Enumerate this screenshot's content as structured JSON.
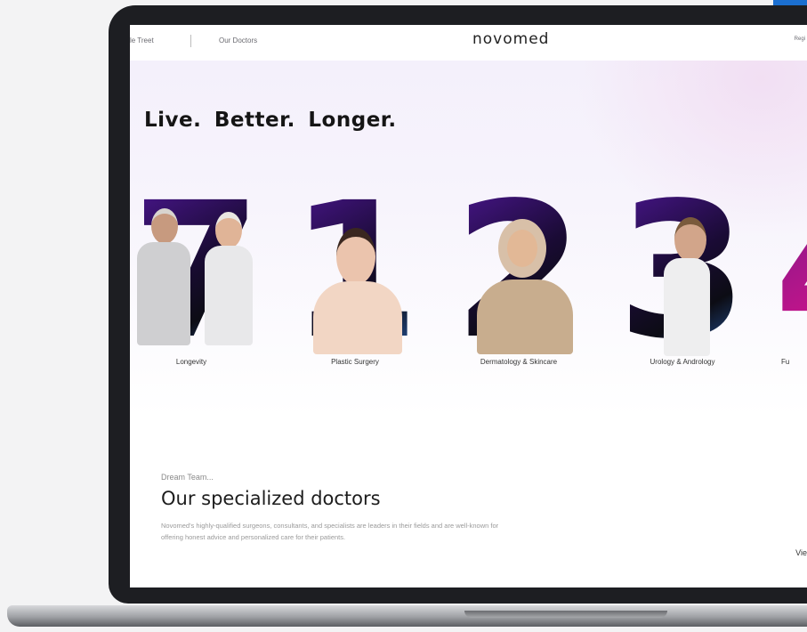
{
  "nav": {
    "left_link": "le Treet",
    "doctors_link": "Our Doctors",
    "logo": "novomed",
    "right_link": "Regi"
  },
  "hero": {
    "tagline": "Live.  Better.  Longer."
  },
  "categories": [
    {
      "number": "7",
      "label": "Longevity"
    },
    {
      "number": "1",
      "label": "Plastic Surgery"
    },
    {
      "number": "2",
      "label": "Dermatology & Skincare"
    },
    {
      "number": "3",
      "label": "Urology & Andrology"
    },
    {
      "number": "4",
      "label": "Fu"
    }
  ],
  "team": {
    "kicker": "Dream Team...",
    "title": "Our specialized doctors",
    "description": "Novomed's highly-qualified surgeons, consultants, and specialists are leaders in their fields and are well-known for offering honest advice and personalized care for their patients.",
    "view_link": "Vie"
  },
  "colors": {
    "numeral_dark": "#1a0b35",
    "numeral_purple": "#4b1690",
    "numeral_blue": "#2a5fb0",
    "hero_tint": "#f4f0fb",
    "laptop_bezel": "#1d1e22"
  }
}
